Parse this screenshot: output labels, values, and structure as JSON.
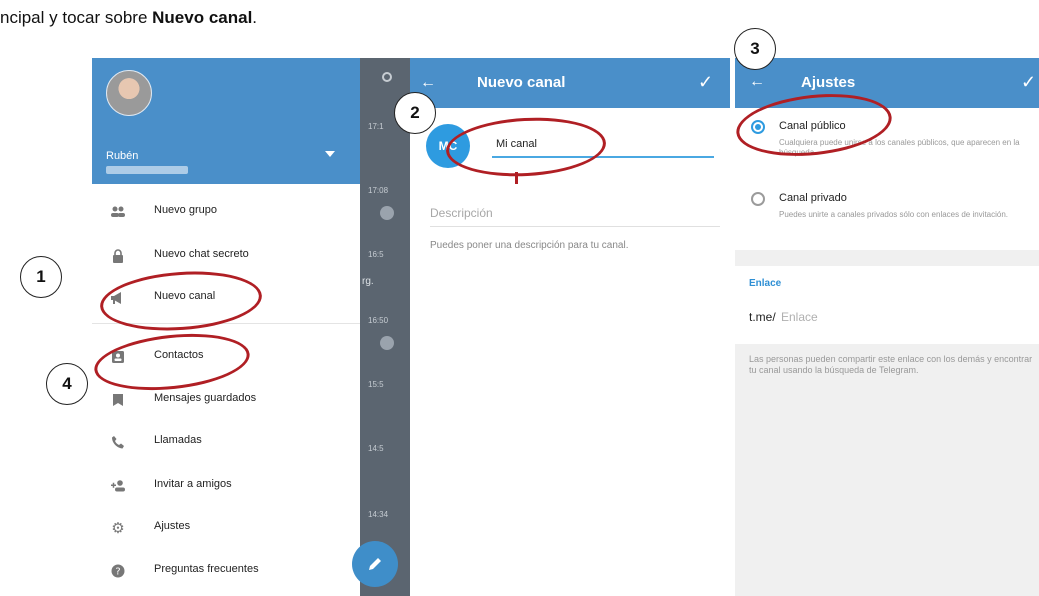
{
  "caption": {
    "prefix": "ncipal y tocar sobre ",
    "bold": "Nuevo canal",
    "suffix": "."
  },
  "drawer": {
    "user_name": "Rubén",
    "menu": [
      {
        "label": "Nuevo grupo",
        "icon": "group-icon"
      },
      {
        "label": "Nuevo chat secreto",
        "icon": "lock-icon"
      },
      {
        "label": "Nuevo canal",
        "icon": "megaphone-icon"
      },
      {
        "label": "Contactos",
        "icon": "contact-card-icon"
      },
      {
        "label": "Mensajes guardados",
        "icon": "bookmark-icon"
      },
      {
        "label": "Llamadas",
        "icon": "phone-icon"
      },
      {
        "label": "Invitar a amigos",
        "icon": "add-person-icon"
      },
      {
        "label": "Ajustes",
        "icon": "gear-icon"
      },
      {
        "label": "Preguntas frecuentes",
        "icon": "help-icon"
      }
    ]
  },
  "chatlist": {
    "times": [
      "17:1",
      "17:08",
      "16:5",
      "16:50",
      "15:5",
      "14:5",
      "14:34"
    ],
    "fragment": "rg."
  },
  "new_channel": {
    "title": "Nuevo canal",
    "avatar_initials": "MC",
    "name_value": "Mi canal",
    "description_placeholder": "Descripción",
    "description_help": "Puedes poner una descripción para tu canal."
  },
  "settings": {
    "title": "Ajustes",
    "public_label": "Canal público",
    "public_desc": "Cualquiera puede unirse a los canales públicos, que aparecen en la búsqueda.",
    "private_label": "Canal privado",
    "private_desc": "Puedes unirte a canales privados sólo con enlaces de invitación.",
    "link_heading": "Enlace",
    "link_prefix": "t.me/",
    "link_placeholder": "Enlace",
    "link_help": "Las personas pueden compartir este enlace con los demás y encontrar tu canal usando la búsqueda de Telegram."
  },
  "callouts": [
    "1",
    "2",
    "3",
    "4"
  ],
  "colors": {
    "header_blue": "#4a8fc9",
    "accent_blue": "#2e9be0",
    "annotation_red": "#b01f24"
  }
}
